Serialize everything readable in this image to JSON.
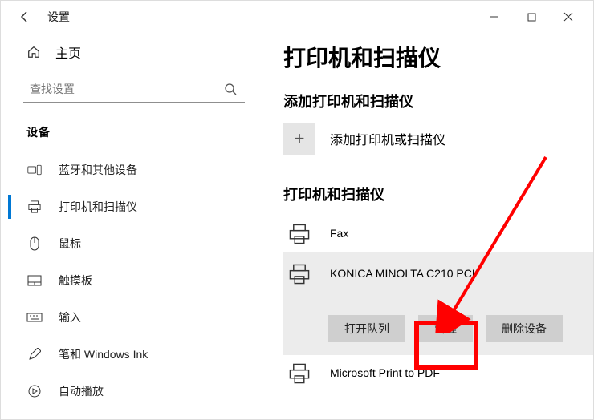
{
  "window": {
    "title": "设置"
  },
  "sidebar": {
    "home": "主页",
    "search_placeholder": "查找设置",
    "category": "设备",
    "items": [
      {
        "label": "蓝牙和其他设备"
      },
      {
        "label": "打印机和扫描仪"
      },
      {
        "label": "鼠标"
      },
      {
        "label": "触摸板"
      },
      {
        "label": "输入"
      },
      {
        "label": "笔和 Windows Ink"
      },
      {
        "label": "自动播放"
      }
    ]
  },
  "main": {
    "heading": "打印机和扫描仪",
    "add_heading": "添加打印机和扫描仪",
    "add_label": "添加打印机或扫描仪",
    "list_heading": "打印机和扫描仪",
    "printers": [
      {
        "name": "Fax"
      },
      {
        "name": "KONICA MINOLTA C210 PCL"
      },
      {
        "name": "Microsoft Print to PDF"
      }
    ],
    "actions": {
      "open_queue": "打开队列",
      "manage": "管理",
      "remove": "删除设备"
    }
  }
}
